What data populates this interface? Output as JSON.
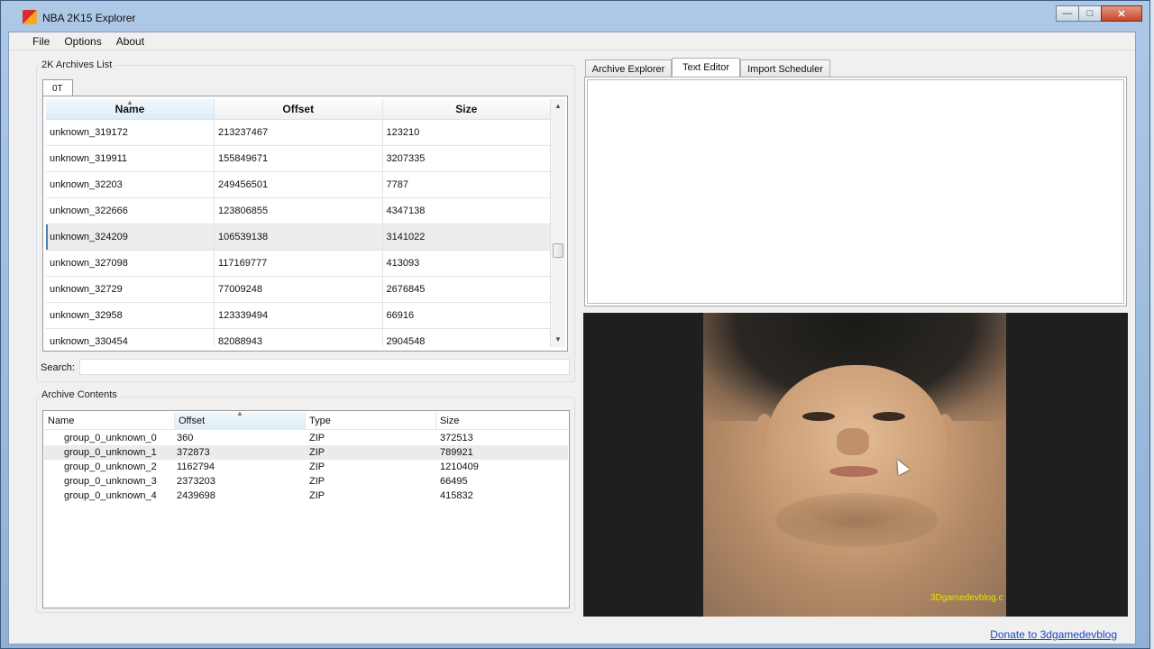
{
  "window": {
    "title": "NBA 2K15 Explorer"
  },
  "menu": [
    "File",
    "Options",
    "About"
  ],
  "archives": {
    "group_title": "2K Archives List",
    "tab": "0T",
    "columns": [
      "Name",
      "Offset",
      "Size"
    ],
    "rows": [
      [
        "unknown_319172",
        "213237467",
        "123210"
      ],
      [
        "unknown_319911",
        "155849671",
        "3207335"
      ],
      [
        "unknown_32203",
        "249456501",
        "7787"
      ],
      [
        "unknown_322666",
        "123806855",
        "4347138"
      ],
      [
        "unknown_324209",
        "106539138",
        "3141022"
      ],
      [
        "unknown_327098",
        "117169777",
        "413093"
      ],
      [
        "unknown_32729",
        "77009248",
        "2676845"
      ],
      [
        "unknown_32958",
        "123339494",
        "66916"
      ],
      [
        "unknown_330454",
        "82088943",
        "2904548"
      ]
    ],
    "selected_row": 4
  },
  "search": {
    "label": "Search:",
    "value": ""
  },
  "contents": {
    "group_title": "Archive Contents",
    "columns": [
      "Name",
      "Offset",
      "Type",
      "Size"
    ],
    "rows": [
      [
        "group_0_unknown_0",
        "360",
        "ZIP",
        "372513"
      ],
      [
        "group_0_unknown_1",
        "372873",
        "ZIP",
        "789921"
      ],
      [
        "group_0_unknown_2",
        "1162794",
        "ZIP",
        "1210409"
      ],
      [
        "group_0_unknown_3",
        "2373203",
        "ZIP",
        "66495"
      ],
      [
        "group_0_unknown_4",
        "2439698",
        "ZIP",
        "415832"
      ]
    ],
    "selected_row": 1
  },
  "right_tabs": [
    "Archive Explorer",
    "Text Editor",
    "Import Scheduler"
  ],
  "active_right_tab": "Text Editor",
  "preview": {
    "watermark": "3Dgamedevblog.c"
  },
  "donate_link": "Donate to 3dgamedevblog"
}
